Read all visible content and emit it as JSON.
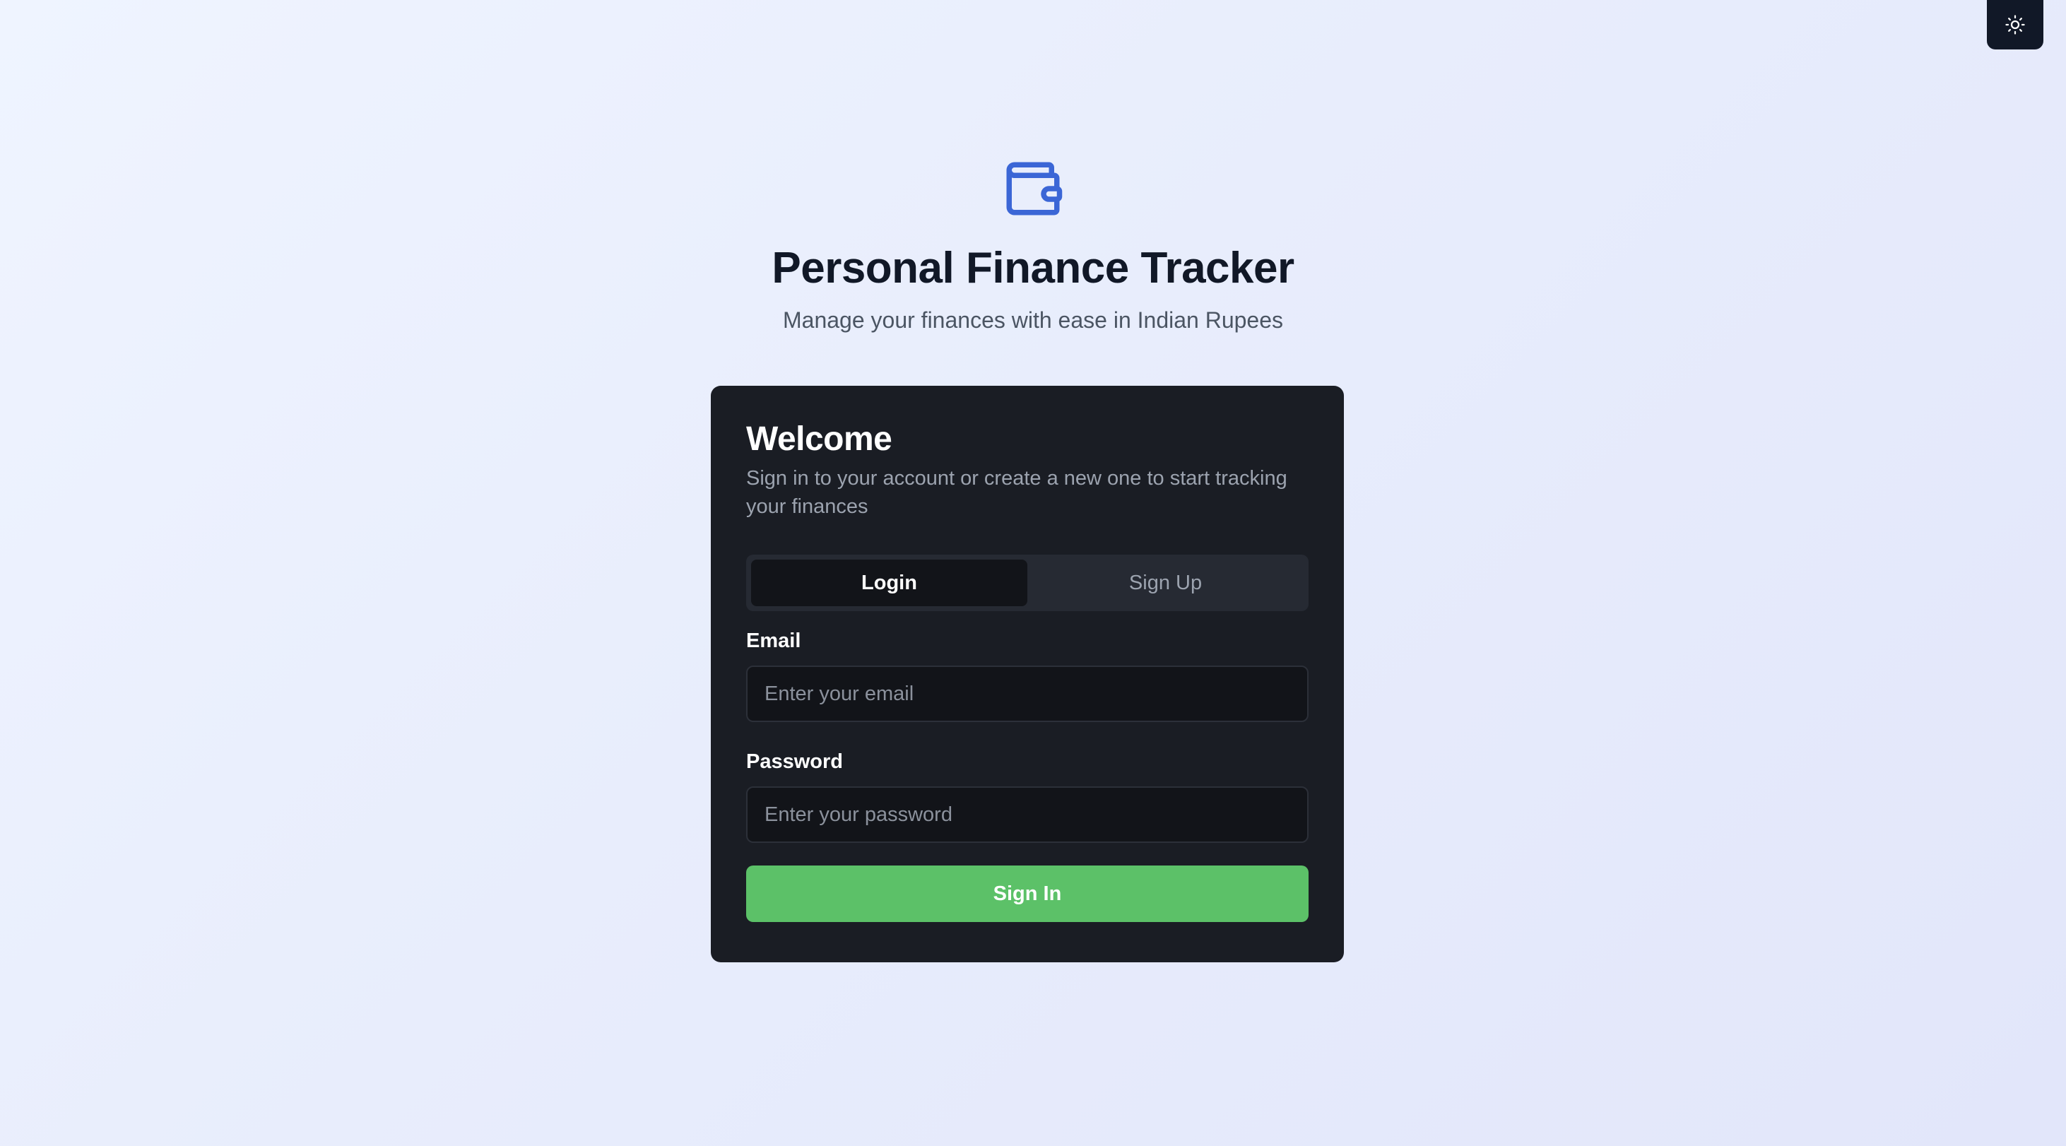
{
  "theme_toggle": {
    "icon": "sun-icon",
    "color": "#111827"
  },
  "header": {
    "logo_icon": "wallet-icon",
    "logo_color": "#3b66d6",
    "title": "Personal Finance Tracker",
    "subtitle": "Manage your finances with ease in Indian Rupees"
  },
  "card": {
    "title": "Welcome",
    "description": "Sign in to your account or create a new one to start tracking your finances",
    "tabs": [
      {
        "label": "Login",
        "active": true
      },
      {
        "label": "Sign Up",
        "active": false
      }
    ],
    "email": {
      "label": "Email",
      "placeholder": "Enter your email",
      "value": ""
    },
    "password": {
      "label": "Password",
      "placeholder": "Enter your password",
      "value": ""
    },
    "submit_label": "Sign In",
    "accent_color": "#5cc168"
  }
}
